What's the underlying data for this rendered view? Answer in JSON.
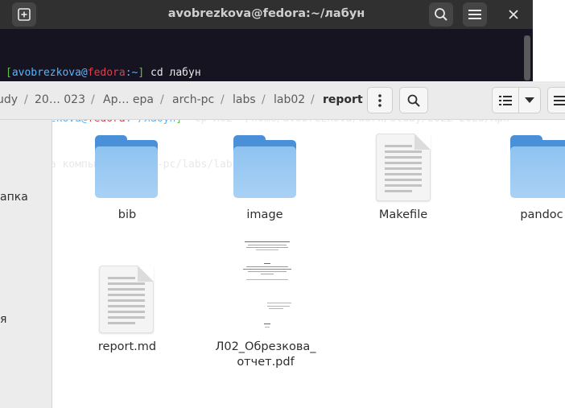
{
  "terminal": {
    "title": "avobrezkova@fedora:~/лабун",
    "lines": [
      {
        "open": "[",
        "user": "avobrezkova",
        "at": "@",
        "host": "fedora",
        "path": ":~",
        "close": "]",
        "cmd": " cd лабун"
      },
      {
        "open": "[",
        "user": "avobrezkova",
        "at": "@",
        "host": "fedora",
        "path": ":~/лабун",
        "close": "]",
        "cmd": "  cp Л02* /home/avobrezkova/work/study/2022-2023/Арх"
      }
    ],
    "wrap_line": "итектура компьютера/arch-pc/labs/lab01/report/"
  },
  "file_manager": {
    "breadcrumbs": [
      "udy",
      "20… 023",
      "Ар… ера",
      "arch-pc",
      "labs",
      "lab02",
      "report"
    ],
    "sidebar": [
      "апка",
      "я"
    ],
    "files": [
      {
        "name": "bib",
        "type": "folder"
      },
      {
        "name": "image",
        "type": "folder"
      },
      {
        "name": "Makefile",
        "type": "text"
      },
      {
        "name": "pandoc",
        "type": "folder"
      },
      {
        "name": "report.md",
        "type": "text"
      },
      {
        "name": "Л02_Обрезкова_",
        "name2": "отчет.pdf",
        "type": "pdf"
      }
    ]
  },
  "icons": [
    "new-tab-icon",
    "search-icon",
    "hamburger-menu-icon",
    "close-icon",
    "kebab-menu-icon",
    "list-view-icon",
    "chevron-down-icon"
  ],
  "colors": {
    "terminal_bg": "#171421",
    "user": "#54b4ff",
    "host": "#e03c4a",
    "bracket": "#62c04a",
    "folder": "#4a90d9"
  }
}
